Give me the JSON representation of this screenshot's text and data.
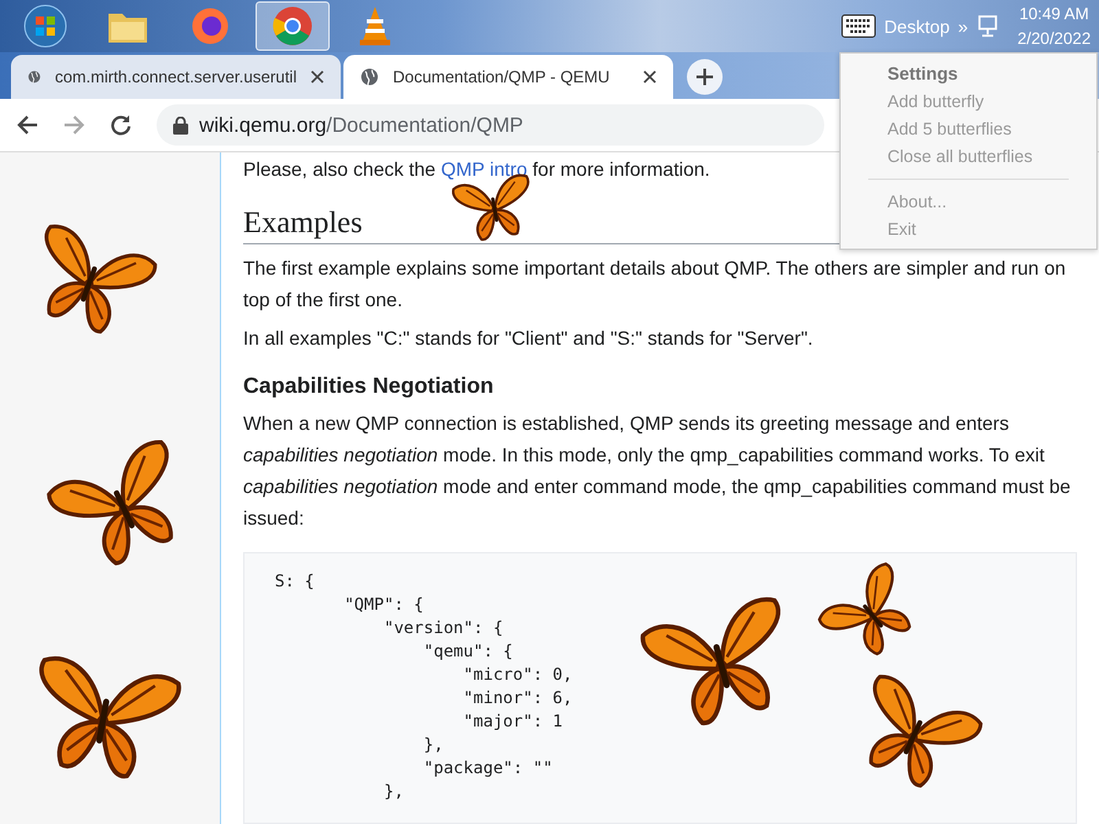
{
  "taskbar": {
    "apps": [
      {
        "kind": "start",
        "selected": false
      },
      {
        "kind": "folder",
        "selected": false
      },
      {
        "kind": "firefox",
        "selected": false
      },
      {
        "kind": "chrome",
        "selected": true
      },
      {
        "kind": "cone",
        "selected": false
      }
    ],
    "toolbar_label": "Desktop",
    "overflow": "»",
    "time": "10:49 AM",
    "date": "2/20/2022"
  },
  "tabs": [
    {
      "title": "com.mirth.connect.server.userutil",
      "selected": false
    },
    {
      "title": "Documentation/QMP - QEMU",
      "selected": true
    }
  ],
  "address": {
    "domain": "wiki.qemu.org",
    "path": "/Documentation/QMP"
  },
  "menu": {
    "items": [
      {
        "kind": "header",
        "label": "Settings"
      },
      {
        "kind": "item",
        "label": "Add butterfly"
      },
      {
        "kind": "item",
        "label": "Add 5 butterflies"
      },
      {
        "kind": "item",
        "label": "Close all butterflies"
      },
      {
        "kind": "separator"
      },
      {
        "kind": "item",
        "label": "About..."
      },
      {
        "kind": "item",
        "label": "Exit"
      }
    ]
  },
  "article": {
    "intro": {
      "before": "Please, also check the ",
      "link": "QMP intro",
      "after": " for more information."
    },
    "blocks": [
      {
        "kind": "h2",
        "text": "Examples"
      },
      {
        "kind": "p",
        "text": "The first example explains some important details about QMP. The others are simpler and run on top of the first one."
      },
      {
        "kind": "p",
        "text": "In all examples \"C:\" stands for \"Client\" and \"S:\" stands for \"Server\"."
      },
      {
        "kind": "h3",
        "text": "Capabilities Negotiation"
      },
      {
        "kind": "p",
        "text": "When a new QMP connection is established, QMP sends its greeting message and enters *capabilities negotiation* mode. In this mode, only the qmp_capabilities command works. To exit *capabilities negotiation* mode and enter command mode, the qmp_capabilities command must be issued:"
      }
    ],
    "code": [
      "S: {",
      "       \"QMP\": {",
      "           \"version\": {",
      "               \"qemu\": {",
      "                   \"micro\": 0,",
      "                   \"minor\": 6,",
      "                   \"major\": 1",
      "               },",
      "               \"package\": \"\"",
      "           },"
    ]
  }
}
